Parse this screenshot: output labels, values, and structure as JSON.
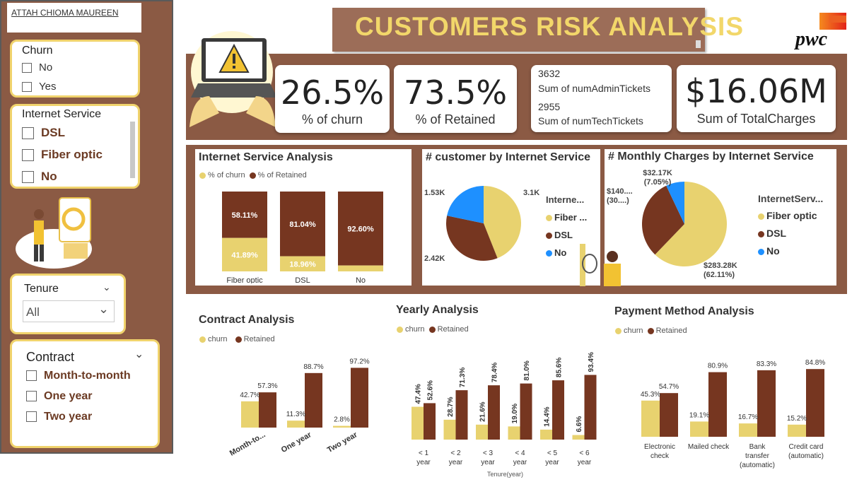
{
  "author": "ATTAH CHIOMA MAUREEN",
  "title": "CUSTOMERS RISK ANALYSIS",
  "logo_text": "pwc",
  "colors": {
    "churn": "#e8d26f",
    "retained": "#763620",
    "brown": "#8b5a44",
    "gold": "#f0d36c",
    "blue": "#1e90ff"
  },
  "slicers": {
    "churn": {
      "title": "Churn",
      "options": [
        "No",
        "Yes"
      ]
    },
    "internet": {
      "title": "Internet Service",
      "options": [
        "DSL",
        "Fiber optic",
        "No"
      ]
    },
    "tenure": {
      "title": "Tenure",
      "value": "All"
    },
    "contract": {
      "title": "Contract",
      "options": [
        "Month-to-month",
        "One year",
        "Two year"
      ]
    }
  },
  "kpis": {
    "churn": {
      "value": "26.5%",
      "label": "% of churn"
    },
    "retained": {
      "value": "73.5%",
      "label": "% of Retained"
    },
    "admin": {
      "value": "3632",
      "label": "Sum of numAdminTickets"
    },
    "tech": {
      "value": "2955",
      "label": "Sum of numTechTickets"
    },
    "charges": {
      "value": "$16.06M",
      "label": "Sum of TotalCharges"
    }
  },
  "internet_analysis": {
    "title": "Internet Service Analysis",
    "legend": [
      "% of churn",
      "% of Retained"
    ]
  },
  "customer_pie": {
    "title": "# customer by Internet Service",
    "legend_title": "Interne...",
    "legend": [
      "Fiber ...",
      "DSL",
      "No"
    ]
  },
  "monthly_pie": {
    "title": "# Monthly Charges by Internet Service",
    "legend_title": "InternetServ...",
    "legend": [
      "Fiber optic",
      "DSL",
      "No"
    ]
  },
  "contract": {
    "title": "Contract Analysis",
    "legend": [
      "churn",
      "Retained"
    ]
  },
  "yearly": {
    "title": "Yearly Analysis",
    "legend": [
      "churn",
      "Retained"
    ],
    "axis_title": "Tenure(year)"
  },
  "payment": {
    "title": "Payment Method Analysis",
    "legend": [
      "churn",
      "Retained"
    ]
  },
  "chart_data": [
    {
      "type": "bar",
      "stacked": true,
      "title": "Internet Service Analysis",
      "categories": [
        "Fiber optic",
        "DSL",
        "No"
      ],
      "series": [
        {
          "name": "% of churn",
          "values": [
            41.89,
            18.96,
            7.4
          ],
          "labels": [
            "41.89%",
            "18.96%",
            ""
          ]
        },
        {
          "name": "% of Retained",
          "values": [
            58.11,
            81.04,
            92.6
          ],
          "labels": [
            "58.11%",
            "81.04%",
            "92.60%"
          ]
        }
      ]
    },
    {
      "type": "pie",
      "title": "# customer by Internet Service",
      "categories": [
        "Fiber optic",
        "DSL",
        "No"
      ],
      "values": [
        3100,
        2420,
        1530
      ],
      "labels": [
        "3.1K",
        "2.42K",
        "1.53K"
      ]
    },
    {
      "type": "pie",
      "title": "# Monthly Charges by Internet Service",
      "categories": [
        "Fiber optic",
        "DSL",
        "No"
      ],
      "values": [
        283.28,
        140.0,
        32.17
      ],
      "labels": [
        "$283.28K\n(62.11%)",
        "$140....\n(30....)",
        "$32.17K\n(7.05%)"
      ]
    },
    {
      "type": "bar",
      "title": "Contract Analysis",
      "categories": [
        "Month-to...",
        "One year",
        "Two year"
      ],
      "series": [
        {
          "name": "churn",
          "values": [
            42.7,
            11.3,
            2.8
          ]
        },
        {
          "name": "Retained",
          "values": [
            57.3,
            88.7,
            97.2
          ]
        }
      ]
    },
    {
      "type": "bar",
      "title": "Yearly Analysis",
      "xlabel": "Tenure(year)",
      "categories": [
        "< 1 year",
        "< 2 year",
        "< 3 year",
        "< 4 year",
        "< 5 year",
        "< 6 year"
      ],
      "series": [
        {
          "name": "churn",
          "values": [
            47.4,
            28.7,
            21.6,
            19.0,
            14.4,
            6.6
          ]
        },
        {
          "name": "Retained",
          "values": [
            52.6,
            71.3,
            78.4,
            81.0,
            85.6,
            93.4
          ]
        }
      ]
    },
    {
      "type": "bar",
      "title": "Payment Method Analysis",
      "categories": [
        "Electronic check",
        "Mailed check",
        "Bank transfer (automatic)",
        "Credit card (automatic)"
      ],
      "series": [
        {
          "name": "churn",
          "values": [
            45.3,
            19.1,
            16.7,
            15.2
          ]
        },
        {
          "name": "Retained",
          "values": [
            54.7,
            80.9,
            83.3,
            84.8
          ]
        }
      ]
    }
  ]
}
